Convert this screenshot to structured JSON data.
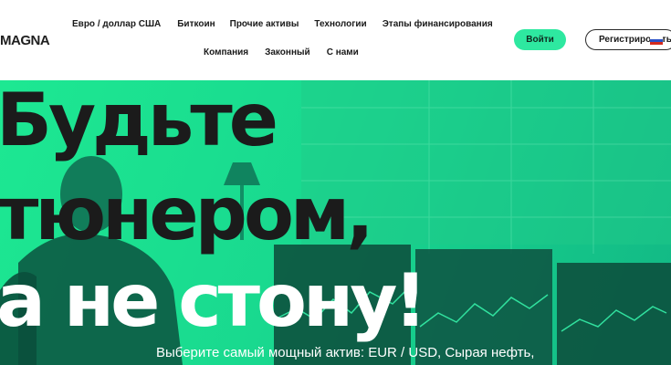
{
  "brand": {
    "logo_text": "MAGNA"
  },
  "nav": {
    "row1": [
      "Евро / доллар США",
      "Биткоин",
      "Прочие активы",
      "Технологии",
      "Этапы финансирования"
    ],
    "row2": [
      "Компания",
      "Законный",
      "С нами"
    ]
  },
  "auth": {
    "login_label": "Войти",
    "register_label": "Регистрировать"
  },
  "hero": {
    "line1": "Будьте",
    "line2": "тюнером,",
    "line3": "а не стону!",
    "subtitle": "Выберите самый мощный актив: EUR / USD, Сырая нефть,"
  },
  "colors": {
    "accent": "#2ee8a0",
    "hero_green": "#1de892",
    "text_dark": "#1b1b1b"
  },
  "icons": {
    "flag": "russia-flag-icon"
  }
}
